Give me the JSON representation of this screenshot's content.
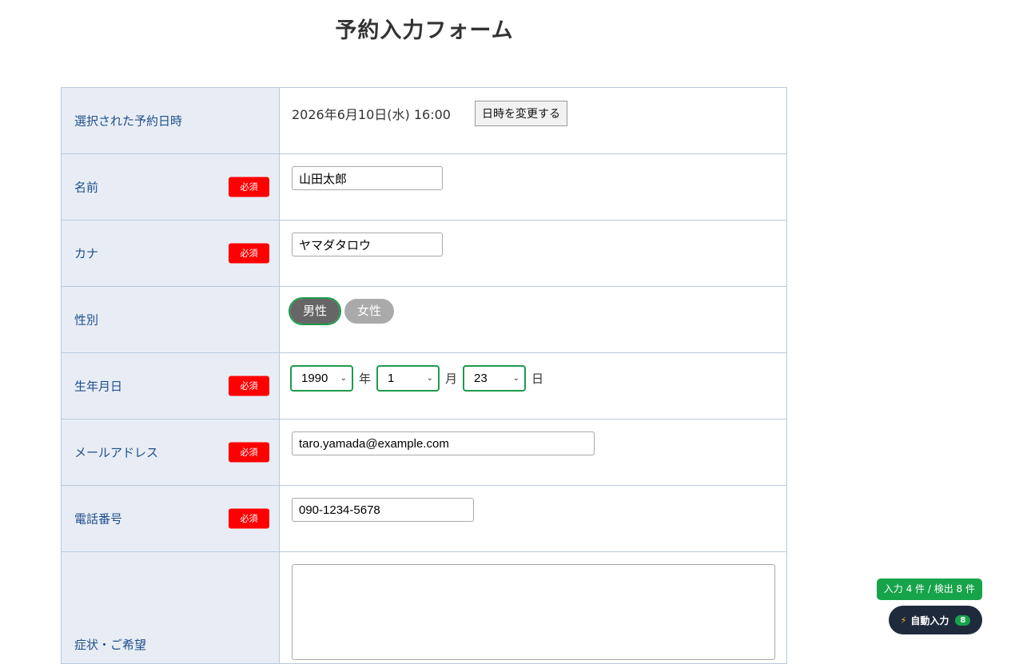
{
  "page": {
    "title": "予約入力フォーム"
  },
  "form": {
    "required_label": "必須",
    "datetime": {
      "label": "選択された予約日時",
      "value": "2026年6月10日(水) 16:00",
      "change_button": "日時を変更する"
    },
    "name": {
      "label": "名前",
      "value": "山田太郎"
    },
    "kana": {
      "label": "カナ",
      "value": "ヤマダタロウ"
    },
    "gender": {
      "label": "性別",
      "options": [
        "男性",
        "女性"
      ],
      "selected": "男性"
    },
    "birthdate": {
      "label": "生年月日",
      "year": "1990",
      "year_unit": "年",
      "month": "1",
      "month_unit": "月",
      "day": "23",
      "day_unit": "日"
    },
    "email": {
      "label": "メールアドレス",
      "value": "taro.yamada@example.com"
    },
    "phone": {
      "label": "電話番号",
      "value": "090-1234-5678"
    },
    "symptoms": {
      "label": "症状・ご希望"
    }
  },
  "autofill": {
    "status": "入力 4 件 / 検出 8 件",
    "button_label": "自動入力",
    "count": "8",
    "bolt_icon": "lightning-icon"
  },
  "colors": {
    "label_bg": "#e8edf5",
    "label_text": "#1f4e8c",
    "required_bg": "#ff0000",
    "focus_green": "#1e9b4a",
    "autofill_dark": "#1f2a3d",
    "autofill_green": "#17a34a"
  }
}
